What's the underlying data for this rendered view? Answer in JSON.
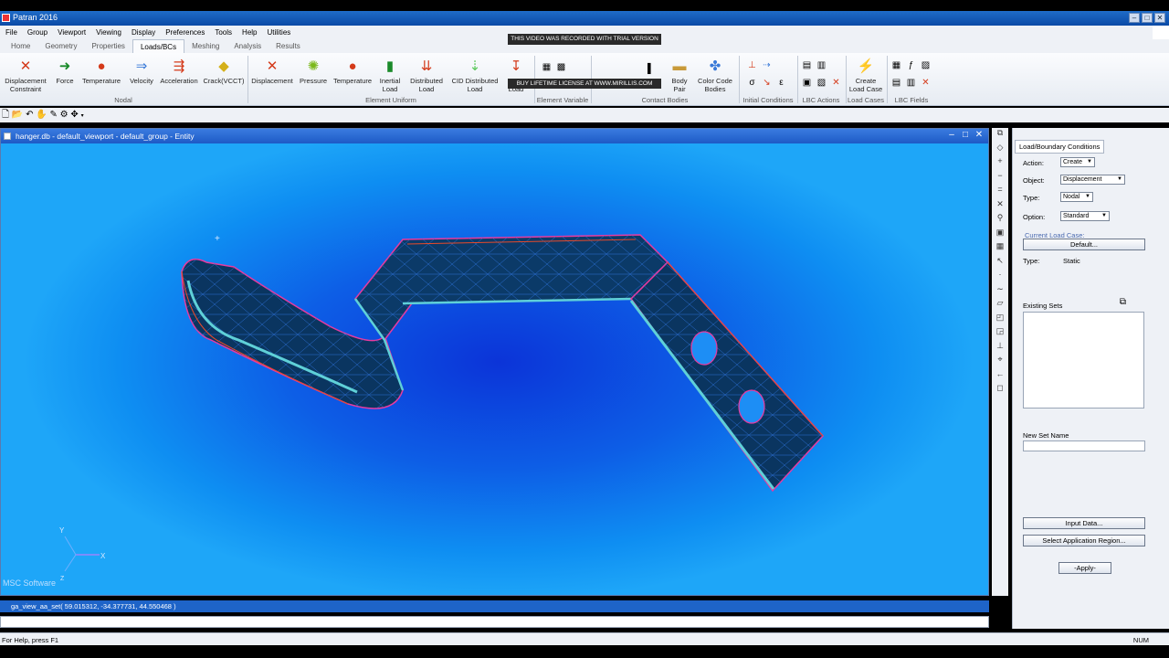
{
  "app": {
    "title": "Patran 2016"
  },
  "menu": [
    "File",
    "Group",
    "Viewport",
    "Viewing",
    "Display",
    "Preferences",
    "Tools",
    "Help",
    "Utilities"
  ],
  "tabs": [
    "Home",
    "Geometry",
    "Properties",
    "Loads/BCs",
    "Meshing",
    "Analysis",
    "Results"
  ],
  "ribbon": {
    "nodal": [
      {
        "label1": "Displacement",
        "label2": "Constraint",
        "icon": "displacement-icon",
        "color": "#d43a1a"
      },
      {
        "label1": "Force",
        "label2": "",
        "icon": "force-icon",
        "color": "#1a8a2a"
      },
      {
        "label1": "Temperature",
        "label2": "",
        "icon": "temperature-icon",
        "color": "#d43a1a"
      },
      {
        "label1": "Velocity",
        "label2": "",
        "icon": "velocity-icon",
        "color": "#3a7ad8"
      },
      {
        "label1": "Acceleration",
        "label2": "",
        "icon": "acceleration-icon",
        "color": "#d43a1a"
      },
      {
        "label1": "Crack(VCCT)",
        "label2": "",
        "icon": "crack-icon",
        "color": "#d4b01a"
      }
    ],
    "element_uniform": [
      {
        "label1": "Displacement",
        "label2": "",
        "icon": "displacement-icon",
        "color": "#d43a1a"
      },
      {
        "label1": "Pressure",
        "label2": "",
        "icon": "pressure-icon",
        "color": "#7ab81a"
      },
      {
        "label1": "Temperature",
        "label2": "",
        "icon": "temperature-icon",
        "color": "#d43a1a"
      },
      {
        "label1": "Inertial",
        "label2": "Load",
        "icon": "inertial-load-icon",
        "color": "#1a8a2a"
      },
      {
        "label1": "Distributed",
        "label2": "Load",
        "icon": "distributed-load-icon",
        "color": "#d43a1a"
      },
      {
        "label1": "CID Distributed",
        "label2": "Load",
        "icon": "cid-distributed-load-icon",
        "color": "#5ac85a"
      },
      {
        "label1": "Load",
        "label2": "",
        "icon": "load-icon",
        "color": "#d43a1a"
      }
    ],
    "contact": [
      {
        "label1": "Body",
        "label2": "Pair",
        "icon": "body-pair-icon",
        "color": "#c89a3a"
      },
      {
        "label1": "Color Code",
        "label2": "Bodies",
        "icon": "color-code-icon",
        "color": "#3a7ad8"
      }
    ],
    "load_cases": {
      "label1": "Create",
      "label2": "Load Case",
      "icon": "create-load-case-icon",
      "color": "#d43a1a"
    },
    "groups": [
      "Nodal",
      "Element Uniform",
      "Element Variable",
      "Contact Bodies",
      "Initial Conditions",
      "LBC Actions",
      "Load Cases",
      "LBC Fields"
    ]
  },
  "watermark": {
    "top": "THIS VIDEO WAS RECORDED WITH TRIAL VERSION",
    "bottom": "BUY LIFETIME LICENSE AT WWW.MIRILLIS.COM"
  },
  "viewport": {
    "title": "hanger.db - default_viewport - default_group - Entity",
    "logo": "MSC Software",
    "axis_y": "Y",
    "axis_x": "X",
    "axis_z": "Z"
  },
  "panel": {
    "tab": "Load/Boundary Conditions",
    "action_label": "Action:",
    "action_value": "Create",
    "object_label": "Object:",
    "object_value": "Displacement",
    "type_label": "Type:",
    "type_value": "Nodal",
    "option_label": "Option:",
    "option_value": "Standard",
    "current_load_case_label": "Current Load Case:",
    "current_load_case_value": "Default",
    "type2_label": "Type:",
    "type2_value": "Static",
    "existing_sets_label": "Existing Sets",
    "new_set_label": "New Set Name",
    "input_data_button": "Input Data...",
    "select_region_button": "Select Application Region...",
    "apply_button": "-Apply-"
  },
  "command": {
    "text": "ga_view_aa_set( 59.015312, -34.377731, 44.550468 )"
  },
  "status": {
    "help": "For Help, press F1",
    "num": "NUM"
  }
}
